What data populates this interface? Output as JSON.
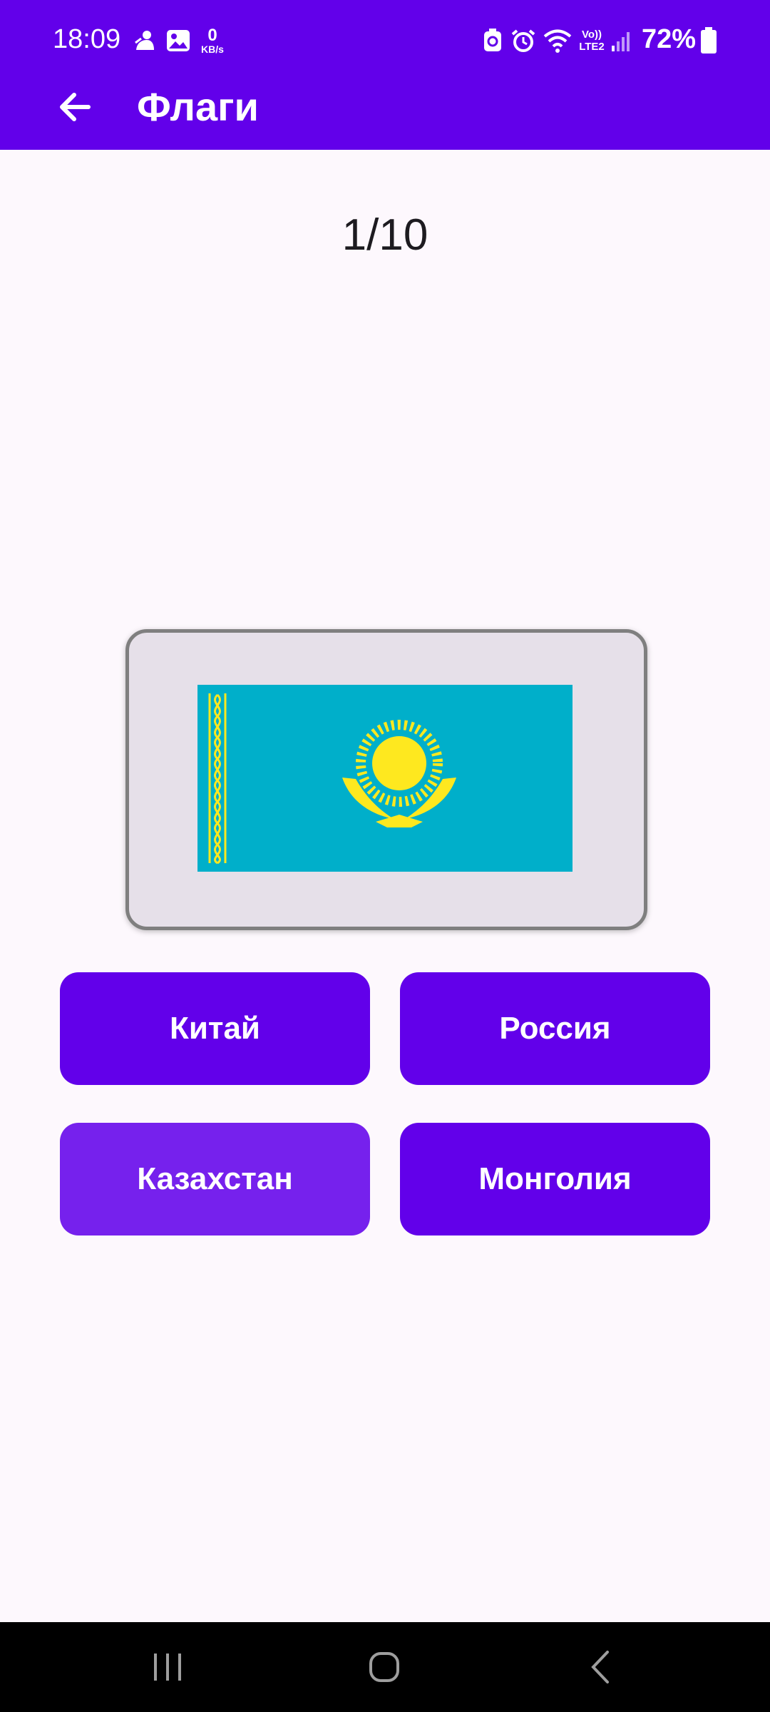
{
  "status_bar": {
    "time": "18:09",
    "net_speed_value": "0",
    "net_speed_unit": "KB/s",
    "network_label_top": "Vo))",
    "network_label_bottom": "LTE2",
    "battery": "72%",
    "icons": [
      "notification-icon",
      "gallery-icon",
      "battery-saver-icon",
      "alarm-icon",
      "wifi-icon",
      "signal-icon",
      "battery-icon"
    ]
  },
  "app_bar": {
    "title": "Флаги",
    "back_icon": "arrow-back-icon"
  },
  "quiz": {
    "counter": "1/10",
    "flag_country": "kazakhstan-flag",
    "answers": [
      "Китай",
      "Россия",
      "Казахстан",
      "Монголия"
    ]
  },
  "colors": {
    "primary": "#6200ea",
    "pressed": "#7621ed",
    "card": "#e6e0e9",
    "flag_blue": "#00afca",
    "flag_gold": "#fee81f"
  },
  "nav_bar": {
    "icons": [
      "recents-icon",
      "home-icon",
      "back-icon"
    ]
  }
}
